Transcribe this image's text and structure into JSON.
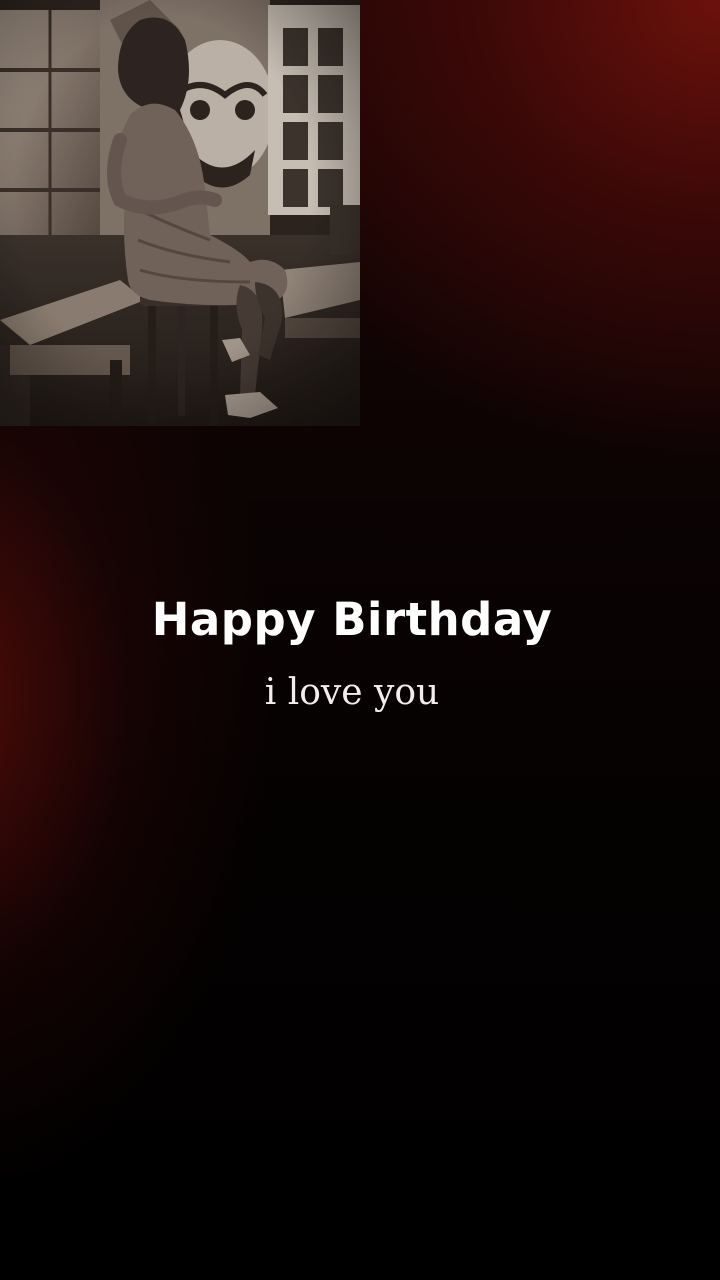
{
  "story": {
    "photo_alt": "",
    "title": "Happy Birthday",
    "subtitle": "i love you"
  },
  "colors": {
    "accent_red": "#70120c",
    "background": "#000000",
    "text": "#ffffff"
  }
}
